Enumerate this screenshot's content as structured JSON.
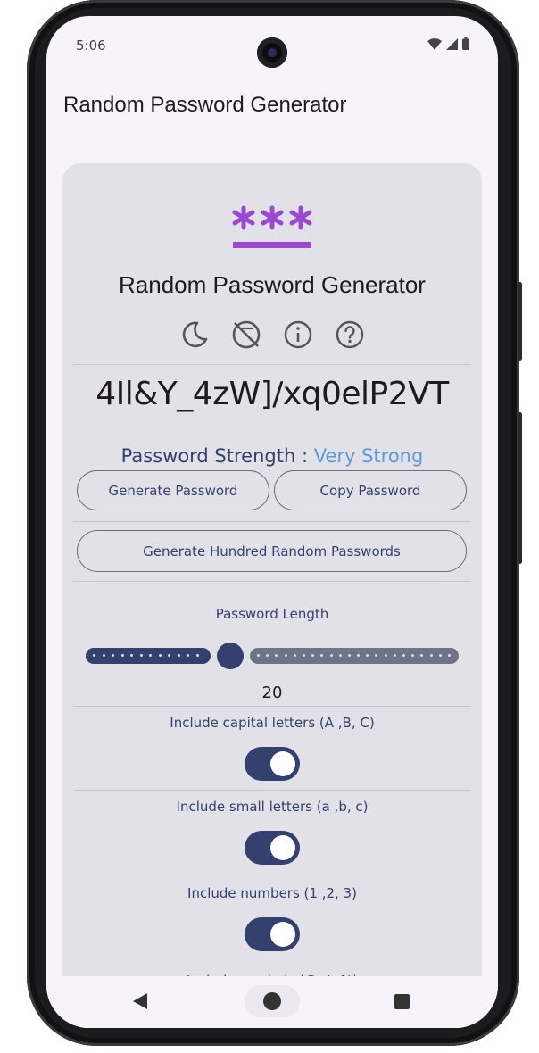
{
  "status_bar": {
    "time": "5:06"
  },
  "app_bar": {
    "title": "Random Password Generator"
  },
  "card": {
    "title": "Random Password Generator",
    "password": "4Il&Y_4zW]/xq0elP2VT",
    "strength_label": "Password Strength : ",
    "strength_value": "Very Strong",
    "buttons": {
      "generate": "Generate Password",
      "copy": "Copy Password",
      "generate_hundred": "Generate Hundred Random Passwords"
    },
    "length": {
      "label": "Password Length",
      "value": "20",
      "fraction": 0.37
    },
    "options": [
      {
        "label": "Include capital letters (A ,B, C)",
        "enabled": true
      },
      {
        "label": "Include small letters (a ,b, c)",
        "enabled": true
      },
      {
        "label": "Include numbers (1 ,2, 3)",
        "enabled": true
      },
      {
        "label": "Include symbols (@ ,!, %)",
        "enabled": true
      }
    ]
  },
  "icons": [
    "moon-icon",
    "no-ads-icon",
    "info-icon",
    "help-icon"
  ],
  "colors": {
    "accent": "#34406e",
    "strength": "#5a9bd5",
    "logo": "#9a48d0",
    "card_bg": "#e3e1e8"
  }
}
